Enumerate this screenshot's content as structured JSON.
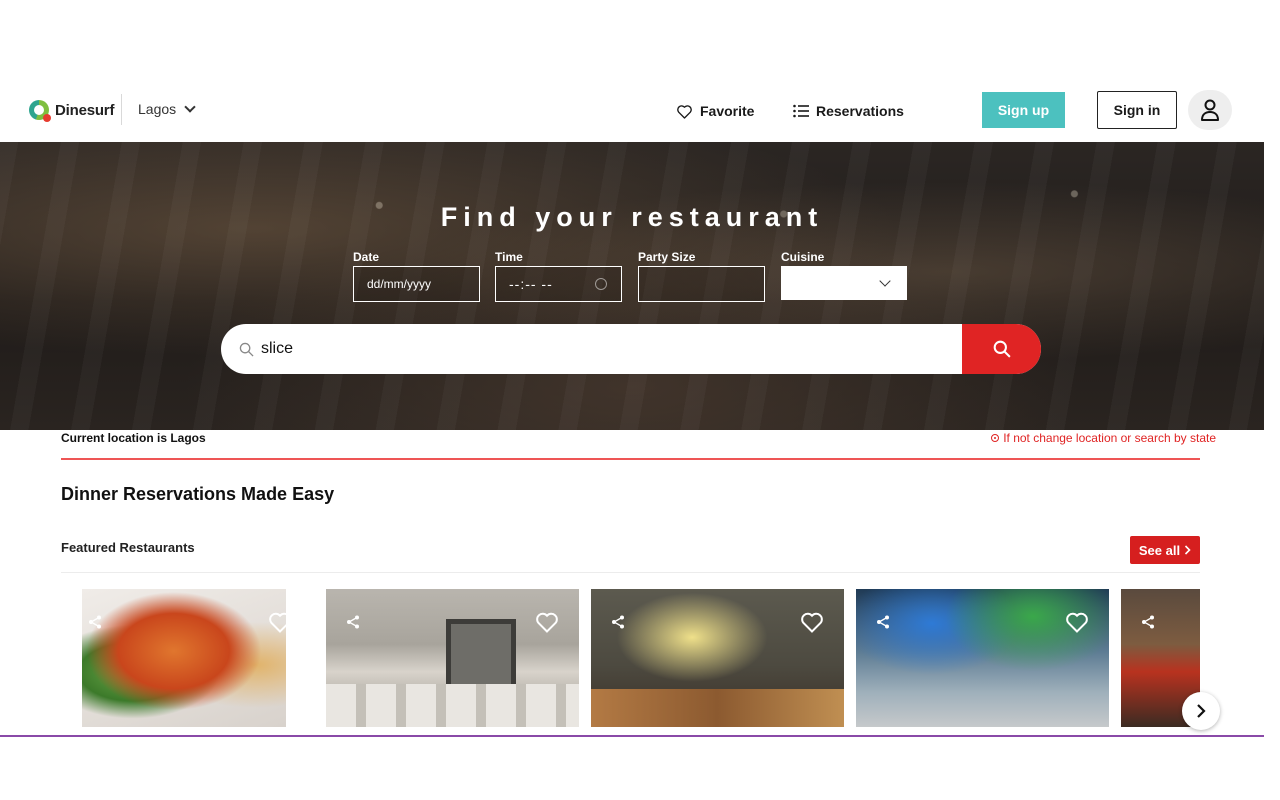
{
  "header": {
    "brand": "Dinesurf",
    "city": "Lagos",
    "nav": {
      "favorite": "Favorite",
      "reservations": "Reservations"
    },
    "sign_up": "Sign up",
    "sign_in": "Sign in"
  },
  "hero": {
    "title": "Find your restaurant",
    "fields": {
      "date_label": "Date",
      "date_placeholder": "dd/mm/yyyy",
      "time_label": "Time",
      "time_placeholder": "--:-- --",
      "party_label": "Party Size",
      "party_value": "",
      "cuisine_label": "Cuisine",
      "cuisine_value": ""
    },
    "search_value": "slice"
  },
  "location": {
    "current": "Current location is Lagos",
    "change_hint": "If not change location or search by state"
  },
  "main": {
    "section_title": "Dinner Reservations Made Easy",
    "featured_title": "Featured Restaurants",
    "see_all": "See all"
  },
  "colors": {
    "brand_teal": "#4cc1bf",
    "accent_red": "#e02424"
  }
}
